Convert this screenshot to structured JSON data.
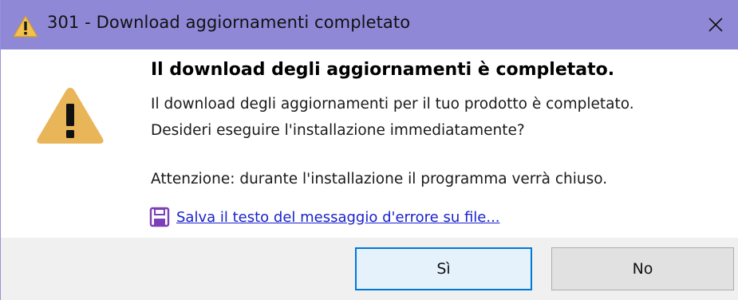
{
  "window": {
    "title": "301 - Download aggiornamenti completato",
    "title_icon": "warning-icon",
    "close_icon": "close-icon"
  },
  "message": {
    "heading": "Il download degli aggiornamenti è completato.",
    "line1": "Il download degli aggiornamenti per il tuo prodotto è completato.",
    "line2": "Desideri  eseguire  l'installazione  immediatamente?",
    "line3": "Attenzione: durante l'installazione il programma verrà chiuso.",
    "icon": "warning-icon"
  },
  "save_link": {
    "label": "Salva il testo del messaggio d'errore su file...",
    "icon": "save-floppy-icon"
  },
  "buttons": {
    "yes": "Sì",
    "no": "No"
  },
  "colors": {
    "titlebar": "#8f88d6",
    "warning": "#e8b558",
    "link": "#1a22cc",
    "default_button_border": "#0078d7"
  }
}
